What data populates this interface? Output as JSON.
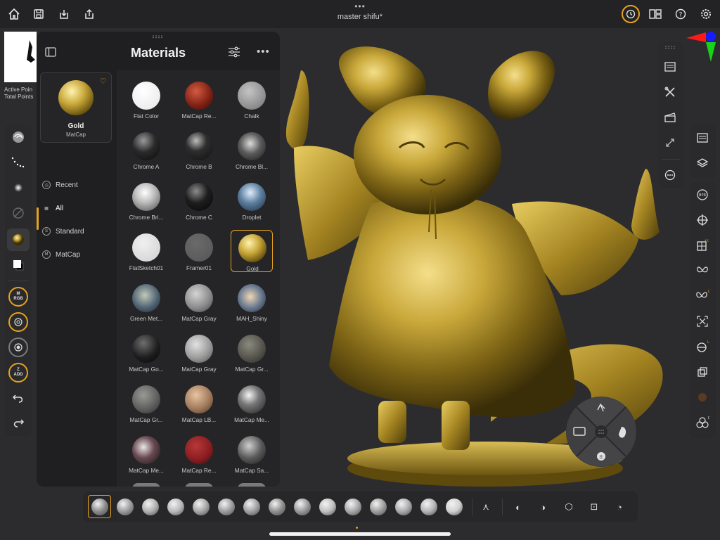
{
  "app": {
    "title": "master shifu*",
    "dots": "•••"
  },
  "stats": {
    "active_points": "Active Poin",
    "total_points": "Total Points"
  },
  "panel": {
    "title": "Materials",
    "current": {
      "name": "Gold",
      "type": "MatCap"
    },
    "categories": [
      {
        "label": "Recent",
        "icon": "clock-icon",
        "glyph": "◷"
      },
      {
        "label": "All",
        "icon": "grid-icon",
        "glyph": "▦"
      },
      {
        "label": "Standard",
        "icon": "standard-icon",
        "glyph": "S"
      },
      {
        "label": "MatCap",
        "icon": "matcap-icon",
        "glyph": "M"
      }
    ],
    "materials": [
      {
        "label": "Flat Color",
        "fill": "radial-gradient(circle at 40% 35%, #ffffff, #e6e6e6)"
      },
      {
        "label": "MatCap Re...",
        "fill": "radial-gradient(circle at 40% 35%, #d45a40, #7a1f12 60%, #3a0d08)"
      },
      {
        "label": "Chalk",
        "fill": "radial-gradient(circle at 40% 35%, #c4c4c4, #8a8a8a 70%, #5e5e5e)"
      },
      {
        "label": "Chrome A",
        "fill": "radial-gradient(circle at 40% 30%, #9a9a9a, #2a2a2a 45%, #0a0a0a)"
      },
      {
        "label": "Chrome B",
        "fill": "radial-gradient(circle at 40% 30%, #bdbdbd, #2e2e2e 40%, #101010)"
      },
      {
        "label": "Chrome Bl...",
        "fill": "radial-gradient(circle at 45% 40%, #dcdcdc, #5c5c5c 45%, #161616)"
      },
      {
        "label": "Chrome Bri...",
        "fill": "radial-gradient(circle at 45% 35%, #ffffff, #bfbfbf 40%, #4a4a4a)"
      },
      {
        "label": "Chrome C",
        "fill": "radial-gradient(circle at 40% 30%, #8c8c8c, #1e1e1e 45%, #050505)"
      },
      {
        "label": "Droplet",
        "fill": "radial-gradient(circle at 45% 35%, #e0eefa, #5d7ea0 45%, #1c2a3a)"
      },
      {
        "label": "FlatSketch01",
        "fill": "radial-gradient(circle at 40% 35%, #f0f0f0, #cfcfcf)"
      },
      {
        "label": "Framer01",
        "fill": "radial-gradient(circle at 40% 35%, #6a6a6a, #555555)"
      },
      {
        "label": "Gold",
        "fill": "radial-gradient(circle at 38% 32%, #fff3b0, #c9a83a 40%, #6b5410 75%, #2e2406)"
      },
      {
        "label": "Green Met...",
        "fill": "radial-gradient(circle at 45% 40%, #c3c9b8, #4f6373 55%, #1b2128)"
      },
      {
        "label": "MatCap Gray",
        "fill": "radial-gradient(circle at 40% 35%, #d4d4d4, #8c8c8c 55%, #3f3f3f)"
      },
      {
        "label": "MAH_Shiny",
        "fill": "radial-gradient(circle at 45% 45%, #f0d6b4, #6d7d92 50%, #1d2430)"
      },
      {
        "label": "MatCap Go...",
        "fill": "radial-gradient(circle at 40% 30%, #6e6e6e, #1e1e1e 55%, #050505)"
      },
      {
        "label": "MatCap Gray",
        "fill": "radial-gradient(circle at 40% 35%, #e2e2e2, #9a9a9a 55%, #4a4a4a)"
      },
      {
        "label": "MatCap Gr...",
        "fill": "radial-gradient(circle at 40% 35%, #8a8a80, #55554e 55%, #2a2a26)"
      },
      {
        "label": "MatCap Gr...",
        "fill": "radial-gradient(circle at 40% 35%, #9a9a94, #606060 55%, #2c2c2c)"
      },
      {
        "label": "MatCap LB...",
        "fill": "radial-gradient(circle at 40% 35%, #e8c4a2, #a07a5c 55%, #4c3424)"
      },
      {
        "label": "MatCap Me...",
        "fill": "radial-gradient(circle at 40% 35%, #f5f5f5, #777777 40%, #1c1c1c)"
      },
      {
        "label": "MatCap Me...",
        "fill": "radial-gradient(circle at 40% 40%, #e8e8e8, #6a4a52 45%, #141414)"
      },
      {
        "label": "MatCap Re...",
        "fill": "radial-gradient(circle at 40% 35%, #b83838, #8a1e22 55%, #3c0a0c)"
      },
      {
        "label": "MatCap Sa...",
        "fill": "radial-gradient(circle at 40% 35%, #cfcfcf, #5a5a5a 50%, #1a1a1a)"
      }
    ],
    "selected_material": "Gold"
  },
  "left_tools": [
    {
      "name": "brush-swirl-icon",
      "glyph": "◎"
    },
    {
      "name": "stroke-dots-icon",
      "glyph": "⋰"
    },
    {
      "name": "alpha-dot-icon",
      "glyph": "●"
    },
    {
      "name": "texture-off-icon",
      "glyph": "⊘"
    },
    {
      "name": "material-gold-icon",
      "glyph": ""
    },
    {
      "name": "color-swatch-icon",
      "glyph": "▣"
    },
    {
      "name": "mrgb-button",
      "glyph": "M RGB"
    },
    {
      "name": "draw-size-dial",
      "glyph": "◎"
    },
    {
      "name": "intensity-dial",
      "glyph": "◉"
    },
    {
      "name": "zadd-button",
      "glyph": "Z ADD"
    },
    {
      "name": "undo-icon",
      "glyph": "↶"
    },
    {
      "name": "redo-icon",
      "glyph": "↷"
    }
  ],
  "right_tools_a": [
    {
      "name": "palette-menu-icon",
      "glyph": "▤"
    },
    {
      "name": "tools-icon",
      "glyph": "✕"
    },
    {
      "name": "movie-clapper-icon",
      "glyph": "🎬"
    },
    {
      "name": "transform-icon",
      "glyph": "⤡"
    },
    {
      "name": "more-circle-icon",
      "glyph": "⋯"
    }
  ],
  "right_tools_b": [
    {
      "name": "document-icon",
      "glyph": "▤"
    },
    {
      "name": "layers-icon",
      "glyph": "◈"
    }
  ],
  "right_tools_c": [
    {
      "name": "bpr-icon",
      "glyph": "BPR"
    },
    {
      "name": "gyro-icon",
      "glyph": "⊕"
    },
    {
      "name": "xyz-frame-icon",
      "glyph": "⊞"
    },
    {
      "name": "symmetry-butterfly-icon",
      "glyph": "ʚɞ"
    },
    {
      "name": "dynamic-symmetry-icon",
      "glyph": "ʚ"
    },
    {
      "name": "frame-icon",
      "glyph": "⤢"
    },
    {
      "name": "perspective-icon",
      "glyph": "⊖"
    },
    {
      "name": "polyframe-icon",
      "glyph": "◪"
    },
    {
      "name": "texture-sphere-icon",
      "glyph": "●"
    },
    {
      "name": "solo-icon",
      "glyph": "⁂"
    }
  ],
  "bottom_brushes": [
    "#8a8a8a",
    "#9a9a9a",
    "#b0b0b0",
    "#b8b8b8",
    "#a6a6a6",
    "#9c9c9c",
    "#a0a0a0",
    "#8e8e8e",
    "#989898",
    "#c0c0c0",
    "#a8a8a8",
    "#9e9e9e",
    "#aaaaaa",
    "#b4b4b4",
    "#d0d0d0"
  ],
  "bottom_tools": [
    {
      "name": "gizmo-icon",
      "glyph": "⋏"
    },
    {
      "name": "mask-icon",
      "glyph": "◐"
    },
    {
      "name": "select-icon",
      "glyph": "◑"
    },
    {
      "name": "cube-icon",
      "glyph": "⬡"
    },
    {
      "name": "frame-select-icon",
      "glyph": "⊡"
    },
    {
      "name": "inverse-icon",
      "glyph": "◔"
    }
  ],
  "colors": {
    "accent": "#e6a21d",
    "gold": "#c9a83a"
  }
}
